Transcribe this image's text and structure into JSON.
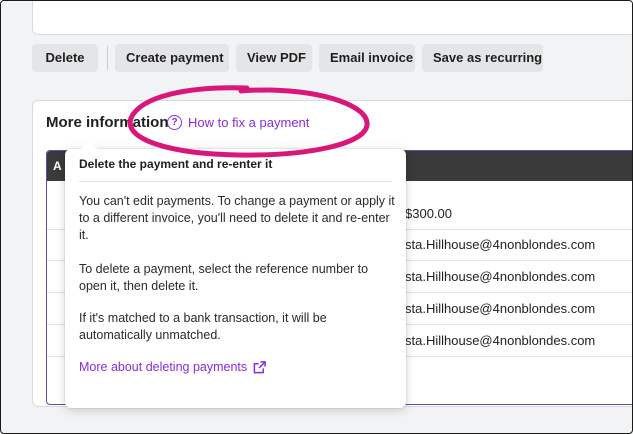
{
  "toolbar": {
    "delete_label": "Delete",
    "create_payment_label": "Create payment",
    "view_pdf_label": "View PDF",
    "email_invoice_label": "Email invoice",
    "save_recurring_label": "Save as recurring"
  },
  "section": {
    "title": "More information",
    "help_link": "How to fix a payment"
  },
  "table": {
    "header_first": "A",
    "rows": [
      "$300.00",
      "sta.Hillhouse@4nonblondes.com",
      "sta.Hillhouse@4nonblondes.com",
      "sta.Hillhouse@4nonblondes.com",
      "sta.Hillhouse@4nonblondes.com"
    ]
  },
  "popover": {
    "title": "Delete the payment and re-enter it",
    "p1": "You can't edit payments. To change a payment or apply it to a different invoice, you'll need to delete it and re-enter it.",
    "p2": "To delete a payment, select the reference number to open it, then delete it.",
    "p3": "If it's matched to a bank transaction, it will be automatically unmatched.",
    "link": "More about deleting payments"
  },
  "colors": {
    "link": "#8a2be2",
    "highlight_ring": "#d9177a",
    "table_header": "#3a3a3a"
  },
  "icons": {
    "help": "question-circle-icon",
    "external": "external-link-icon"
  }
}
